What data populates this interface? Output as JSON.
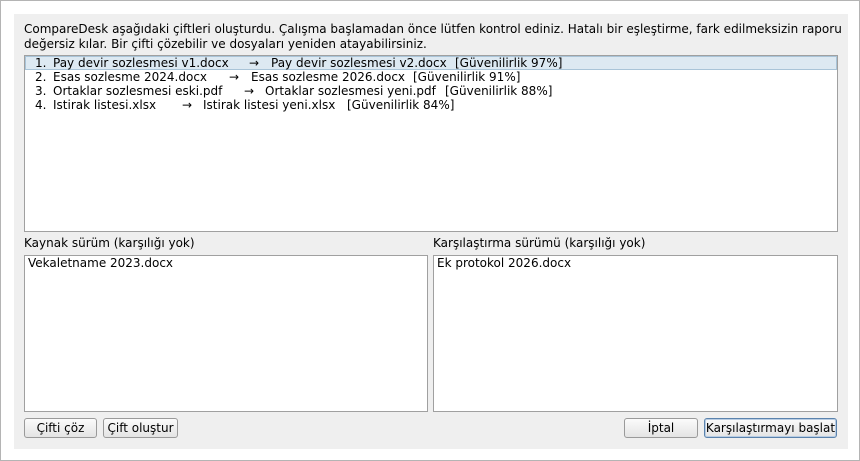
{
  "message": "CompareDesk aşağıdaki çiftleri oluşturdu. Çalışma başlamadan önce lütfen kontrol ediniz. Hatalı bir eşleştirme, fark edilmeksizin raporu değersiz kılar. Bir çifti çözebilir ve dosyaları yeniden atayabilirsiniz.",
  "pairs": [
    {
      "num": "1.",
      "source": "Pay devir sozlesmesi v1.docx",
      "arrow": "→",
      "target": "Pay devir sozlesmesi v2.docx",
      "confidence": "[Güvenilirlik 97%]",
      "selected": true
    },
    {
      "num": "2.",
      "source": "Esas sozlesme 2024.docx",
      "arrow": "→",
      "target": "Esas sozlesme 2026.docx",
      "confidence": "[Güvenilirlik 91%]",
      "selected": false
    },
    {
      "num": "3.",
      "source": "Ortaklar sozlesmesi eski.pdf",
      "arrow": "→",
      "target": "Ortaklar sozlesmesi yeni.pdf",
      "confidence": "[Güvenilirlik 88%]",
      "selected": false
    },
    {
      "num": "4.",
      "source": "Istirak listesi.xlsx",
      "arrow": "→",
      "target": "Istirak listesi yeni.xlsx",
      "confidence": "[Güvenilirlik 84%]",
      "selected": false
    }
  ],
  "source_pane": {
    "label": "Kaynak sürüm (karşılığı yok)",
    "items": [
      "Vekaletname 2023.docx"
    ]
  },
  "compare_pane": {
    "label": "Karşılaştırma sürümü (karşılığı yok)",
    "items": [
      "Ek protokol 2026.docx"
    ]
  },
  "buttons": {
    "unpair": "Çifti çöz",
    "create_pair": "Çift oluştur",
    "cancel": "İptal",
    "start": "Karşılaştırmayı başlat"
  }
}
